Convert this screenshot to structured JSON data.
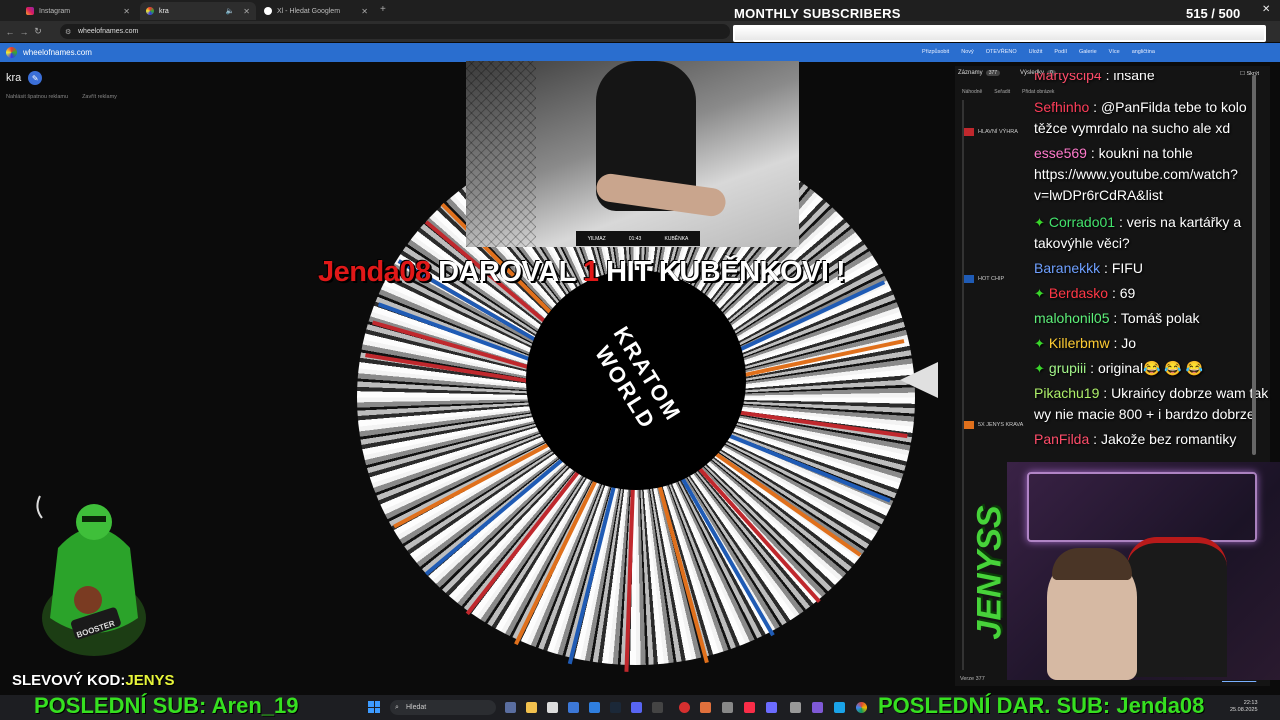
{
  "browser": {
    "tabs": [
      {
        "title": "Instagram"
      },
      {
        "title": "kra"
      },
      {
        "title": "Xl - Hledat Googlem"
      }
    ],
    "url": "wheelofnames.com"
  },
  "site": {
    "name": "wheelofnames.com",
    "menu": [
      "Přizpůsobit",
      "Nový",
      "OTEVŘENO",
      "Uložit",
      "Podíl",
      "Galerie",
      "Více",
      "angličtina"
    ]
  },
  "page": {
    "title": "kra",
    "ad_links": [
      "Nahlásit špatnou reklamu",
      "Zavřít reklamy"
    ]
  },
  "subs_widget": {
    "title": "MONTHLY SUBSCRIBERS",
    "count": "515  / 500",
    "fill_fraction": 1.0
  },
  "wheel": {
    "center_text": "KRATOM WORLD",
    "labels": [
      "HLAVNÍ VÝHRA",
      "HOT CHIP",
      "5X JENYS KRAVA"
    ]
  },
  "video": {
    "scorebug_left": "YILMAZ",
    "scorebug_time": "01:43",
    "scorebug_right": "KUBĚNKA"
  },
  "alert": {
    "name": "Jenda08",
    "text1": "DAROVAL",
    "number": "1",
    "text2": "HIT KUBĚNKOVI !"
  },
  "results_panel": {
    "tabs": [
      {
        "label": "Záznamy",
        "badge": "377"
      },
      {
        "label": "Výsledky",
        "badge": "0"
      }
    ],
    "hide_label": "Skrýt",
    "tools": [
      "Náhodně",
      "Seřadit",
      "Přidat obrázek"
    ],
    "entries": [
      {
        "label": "HLAVNÍ VÝHRA",
        "color": "#c0282d"
      },
      {
        "label": "HOT CHIP",
        "color": "#1f5bb5"
      },
      {
        "label": "5X JENYS KRAVA",
        "color": "#e0701c"
      }
    ],
    "version": "Verze 377",
    "changelog": "seznam změn"
  },
  "chat": [
    {
      "user": "Martyscip4",
      "color": "#ff4d6a",
      "text": "insane",
      "sparkle": false
    },
    {
      "user": "Sefhinho",
      "color": "#ff3e5a",
      "text": "@PanFilda tebe to kolo těžce vymrdalo na sucho ale xd",
      "sparkle": false
    },
    {
      "user": "esse569",
      "color": "#ff7acb",
      "text": "koukni na tohle https://www.youtube.com/watch?v=lwDPr6rCdRA&list",
      "sparkle": false
    },
    {
      "user": "Corrado01",
      "color": "#43e36c",
      "text": "veris na kartářky a takovýhle věci?",
      "sparkle": true
    },
    {
      "user": "Baranekkk",
      "color": "#6fa0ff",
      "text": "FIFU",
      "sparkle": false
    },
    {
      "user": "Berdasko",
      "color": "#ff3846",
      "text": "69",
      "sparkle": true
    },
    {
      "user": "malohonil05",
      "color": "#5ef07a",
      "text": "Tomáš polak",
      "sparkle": false
    },
    {
      "user": "Killerbmw",
      "color": "#ffcc33",
      "text": "Jo",
      "sparkle": true
    },
    {
      "user": "grupiii",
      "color": "#a3f58a",
      "text": "original😂 😂 😂",
      "sparkle": true
    },
    {
      "user": "Pikachu19",
      "color": "#aef06a",
      "text": "Ukraińcy dobrze wam tak wy nie macie 800 + i bardzo dobrze",
      "sparkle": false
    },
    {
      "user": "PanFilda",
      "color": "#ff4d6a",
      "text": "Jakože bez romantiky",
      "sparkle": false
    }
  ],
  "overlay": {
    "coupon_label": "SLEVOVÝ KOD:",
    "coupon_code": "JENYS",
    "last_sub": "POSLEDNÍ SUB: Aren_19",
    "last_donation_sub": "POSLEDNÍ DAR. SUB: Jenda08",
    "jenyss": "JENYSS",
    "mascot_badge": "BOOSTER"
  },
  "taskbar": {
    "search": "Hledat",
    "time": "22:13",
    "date": "25.08.2025"
  }
}
